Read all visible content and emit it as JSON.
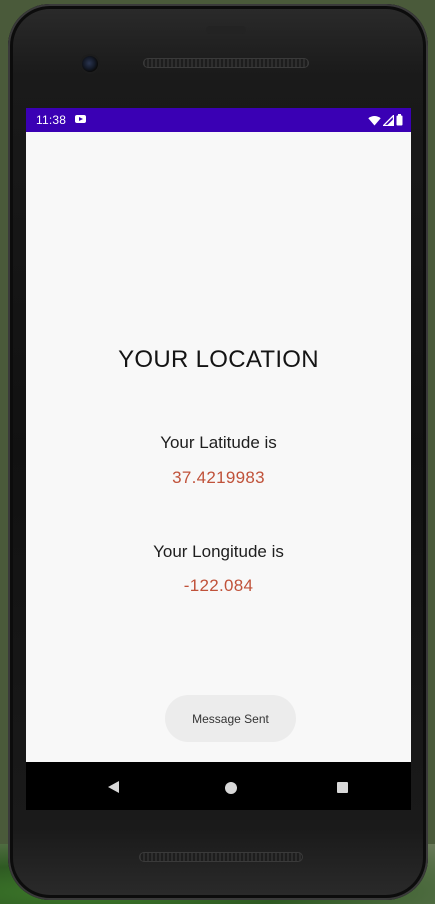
{
  "status_bar": {
    "time": "11:38",
    "background_color": "#3a00b4",
    "notification_icon": "youtube-icon",
    "icons": [
      "wifi-icon",
      "cell-signal-icon",
      "battery-icon"
    ]
  },
  "main": {
    "title": "YOUR LOCATION",
    "latitude_label": "Your Latitude is",
    "latitude_value": "37.4219983",
    "longitude_label": "Your Longitude is",
    "longitude_value": "-122.084",
    "value_color": "#c0523a"
  },
  "toast": {
    "message": "Message Sent"
  },
  "nav_bar": {
    "buttons": [
      "back-icon",
      "home-icon",
      "recents-icon"
    ]
  }
}
